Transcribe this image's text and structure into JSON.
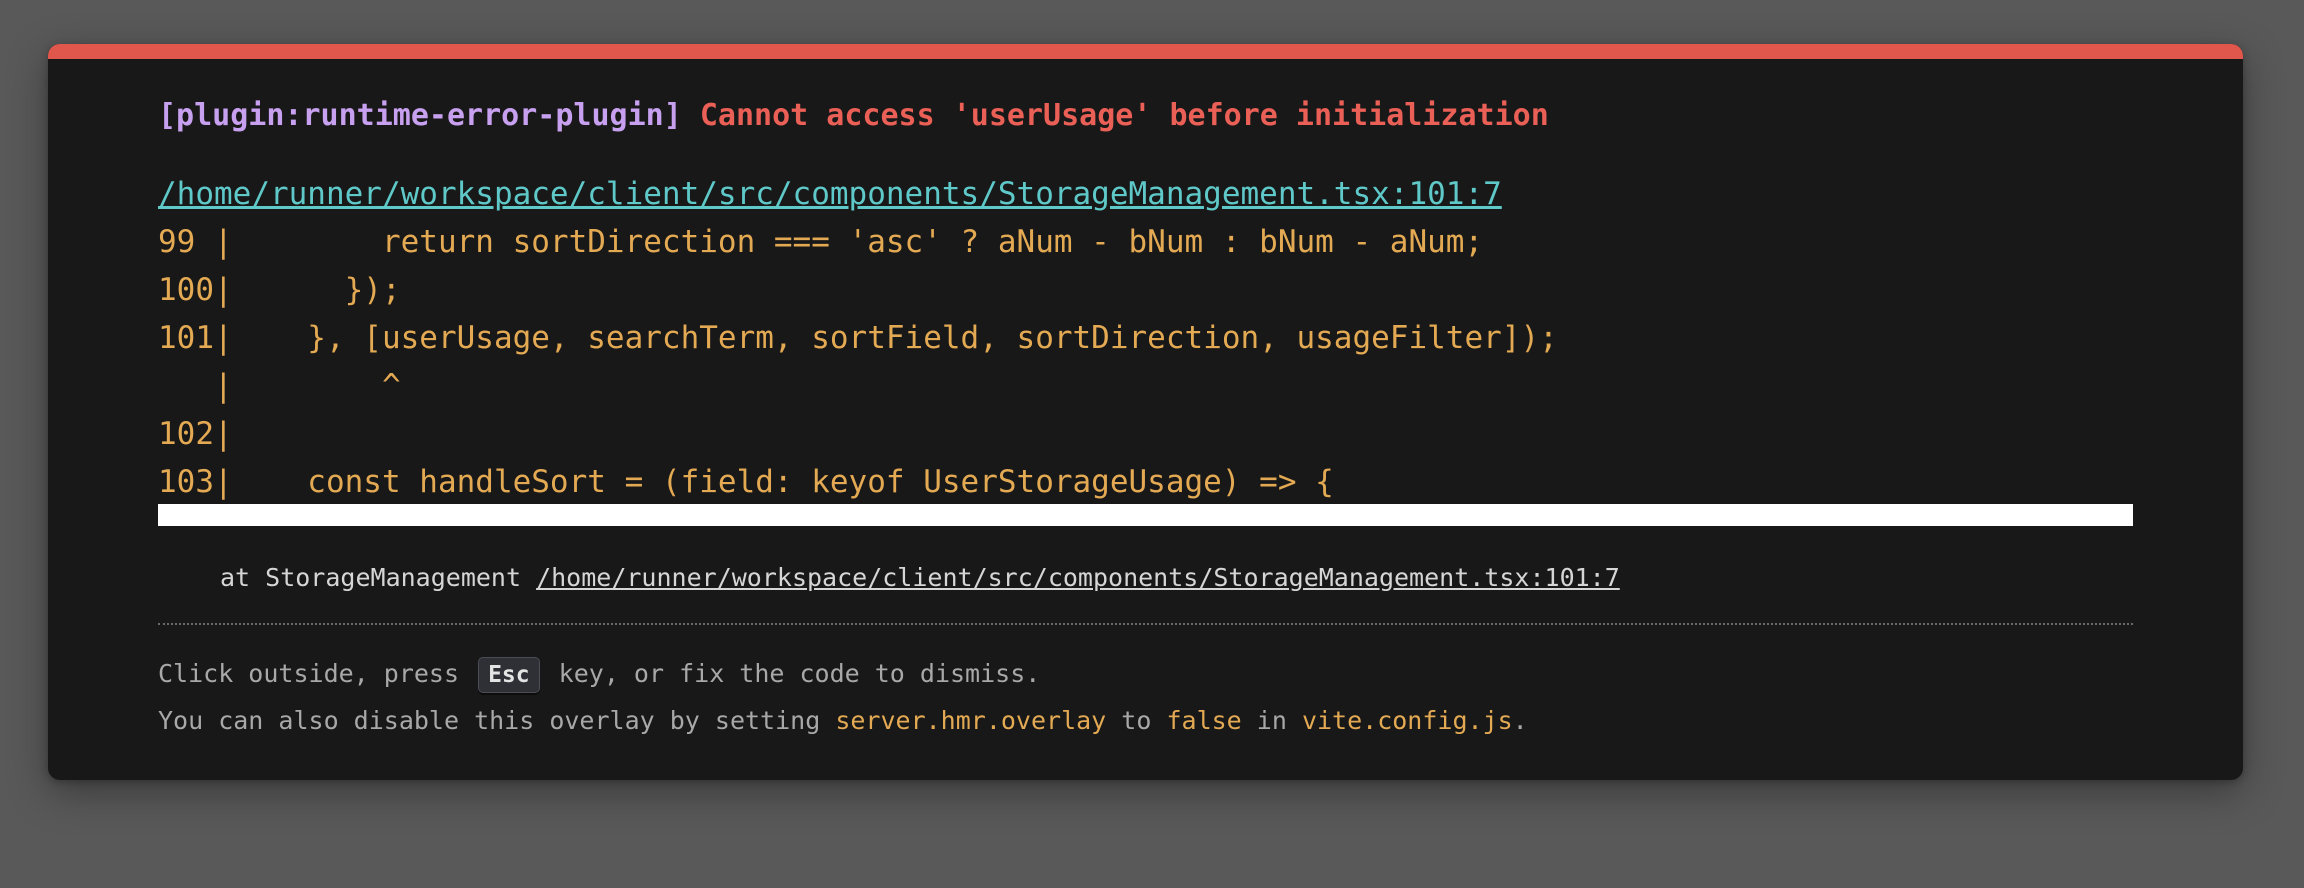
{
  "error": {
    "plugin": "[plugin:runtime-error-plugin]",
    "message": "Cannot access 'userUsage' before initialization",
    "file": "/home/runner/workspace/client/src/components/StorageManagement.tsx:101:7"
  },
  "frame": {
    "lines": [
      "99 |        return sortDirection === 'asc' ? aNum - bNum : bNum - aNum;",
      "100|      });",
      "101|    }, [userUsage, searchTerm, sortField, sortDirection, usageFilter]);",
      "   |        ^",
      "102|",
      "103|    const handleSort = (field: keyof UserStorageUsage) => {"
    ]
  },
  "stack": {
    "prefix": "at StorageManagement ",
    "link": "/home/runner/workspace/client/src/components/StorageManagement.tsx:101:7"
  },
  "tip": {
    "line1_pre": "Click outside, press ",
    "esc_key": "Esc",
    "line1_post": " key, or fix the code to dismiss.",
    "line2_pre": "You can also disable this overlay by setting ",
    "setting": "server.hmr.overlay",
    "line2_mid1": " to ",
    "value": "false",
    "line2_mid2": " in ",
    "config_file": "vite.config.js",
    "line2_end": "."
  },
  "colors": {
    "accent_border": "#e2574c",
    "plugin": "#c8a0f0",
    "message": "#ea5f56",
    "file_link": "#5fc8c8",
    "code": "#e3a953"
  }
}
